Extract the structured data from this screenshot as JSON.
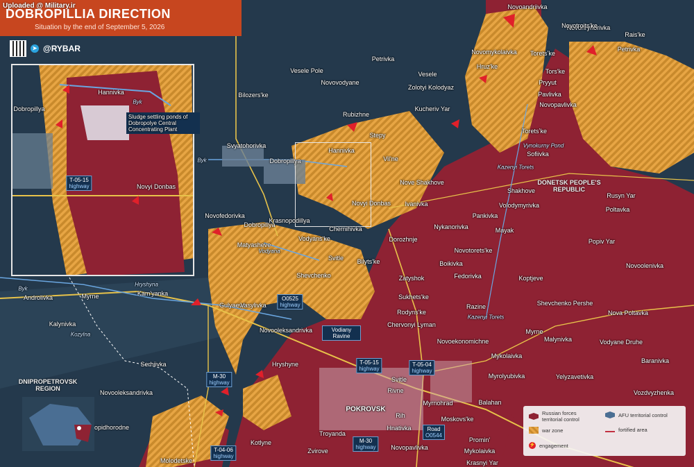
{
  "header": {
    "watermark": "Uploaded @ Military.ir",
    "title": "DOBROPILLIA DIRECTION",
    "subtitle": "Situation by the end of September 5, 2026",
    "brand": "@RYBAR"
  },
  "inset": {
    "places": [
      {
        "name": "Hannivka"
      },
      {
        "name": "Dobropillya"
      },
      {
        "name": "Novyi Donbas"
      }
    ],
    "river": "Byk",
    "note": "Sludge settling ponds of Dobropolye Central Concentrating Plant",
    "highway": {
      "code": "T-05-15",
      "type": "highway"
    }
  },
  "places": [
    "Novoandriivka",
    "Novohryhorivka",
    "Rais'ke",
    "Petrivka",
    "Novotroits'ke",
    "Petrivka",
    "Vesele Pole",
    "Novovodyane",
    "Bilozers'ke",
    "Novomykolaivka",
    "Toretsʼke",
    "Hruz'ke",
    "Tors'ke",
    "Vesele",
    "Zolotyi Kolodyaz",
    "Pryyut",
    "Pavlivka",
    "Novopavlivka",
    "Kucheriv Yar",
    "Rubizhne",
    "Stepy",
    "Toretsʼke",
    "Sofiivka",
    "Svyatohorivka",
    "Hannivka",
    "Dobropillya",
    "Vil'ne",
    "Nove Shakhove",
    "Shakhove",
    "Ivanivka",
    "Novyi Donbas",
    "Rusyn Yar",
    "Poltavka",
    "Volodymyrivka",
    "Pankivka",
    "Novofedorivka",
    "Dobropillya",
    "Krasnopodillya",
    "Chernihivka",
    "Nykanorivka",
    "Mayak",
    "Matyasheve",
    "Vodyans'ke",
    "Dorozhnje",
    "Svitle",
    "Bilyts'ke",
    "Novotorets'ke",
    "Popiv Yar",
    "Shevchenko",
    "Boikivka",
    "Fedorivka",
    "Novoolenivka",
    "Zatyshok",
    "Koptjeve",
    "Androlivka",
    "Myrne",
    "Kam'yanka",
    "Gulyaevo",
    "Vasylivka",
    "Sukhets'ke",
    "Razine",
    "Shevchenko Pershe",
    "Rodyns'ke",
    "Kalynivka",
    "Chervonyi Lyman",
    "Nova Poltavka",
    "Novooleksandrivka",
    "Novoekonomichne",
    "Myrne",
    "Malynivka",
    "Vodyane Druhe",
    "Mykolaivka",
    "Serhiivka",
    "Hryshyne",
    "Svitle",
    "Myrolyubivka",
    "Baranivka",
    "Yelyzavetivka",
    "Novooleksandrivka",
    "Rivne",
    "Myrnohrad",
    "Balahan",
    "Vozdvyzhenka",
    "POKROVSK",
    "Rih",
    "Hnativka",
    "Moskovs'ke",
    "Novopidhorodne",
    "Troyanda",
    "Promin'",
    "Kotlyne",
    "Zvirove",
    "Novopavlivka",
    "Mykolaivka",
    "Molodetske",
    "Krasnyi Yar"
  ],
  "water_labels": [
    "Byk",
    "Vodyana",
    "Hryshyna",
    "Kazenyi Torets",
    "Vynokurny Pond",
    "Byk",
    "Kazenyi Torets",
    "Kozylna"
  ],
  "highways": [
    {
      "code": "O0525",
      "type": "highway"
    },
    {
      "code": "T-05-15",
      "type": "highway"
    },
    {
      "code": "T-05-04",
      "type": "highway"
    },
    {
      "code": "M-30",
      "type": "highway"
    },
    {
      "code": "T-04-06",
      "type": "highway"
    },
    {
      "code": "M-30",
      "type": "highway"
    },
    {
      "code": "Road",
      "type": "O0544"
    }
  ],
  "features": [
    {
      "text": "Vodiany Ravine"
    }
  ],
  "regions": [
    "DONETSK PEOPLE'S REPUBLIC",
    "DNIPROPETROVSK REGION"
  ],
  "legend": {
    "russian": "Russian forces territorial control",
    "afu": "AFU territorial control",
    "war_zone": "war zone",
    "fortified": "fortified area",
    "engagement": "engagement"
  },
  "colors": {
    "russian": "#8e2233",
    "afu": "#24394c",
    "war_zone": "#d9922e",
    "title_bg": "#c7461f",
    "engagement": "#e0202a"
  }
}
